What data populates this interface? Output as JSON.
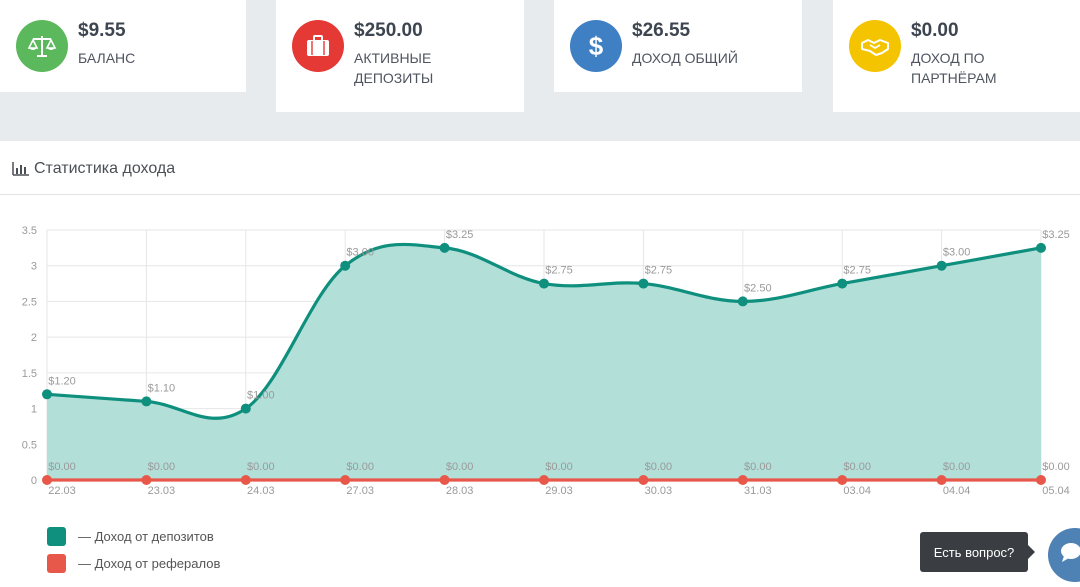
{
  "cards": [
    {
      "value": "$9.55",
      "label": "БАЛАНС",
      "icon": "balance-scale-icon",
      "color": "#5cb85c"
    },
    {
      "value": "$250.00",
      "label": "АКТИВНЫЕ ДЕПОЗИТЫ",
      "icon": "briefcase-icon",
      "color": "#e53935"
    },
    {
      "value": "$26.55",
      "label": "ДОХОД ОБЩИЙ",
      "icon": "dollar-icon",
      "color": "#3f7fc4"
    },
    {
      "value": "$0.00",
      "label": "ДОХОД ПО ПАРТНЁРАМ",
      "icon": "handshake-icon",
      "color": "#f5c400"
    }
  ],
  "panel": {
    "title": "Статистика дохода",
    "icon": "bar-chart-icon"
  },
  "chart_data": {
    "type": "area",
    "categories": [
      "22.03",
      "23.03",
      "24.03",
      "27.03",
      "28.03",
      "29.03",
      "30.03",
      "31.03",
      "03.04",
      "04.04",
      "05.04"
    ],
    "series": [
      {
        "name": "— Доход от депозитов",
        "values": [
          1.2,
          1.1,
          1.0,
          3.0,
          3.25,
          2.75,
          2.75,
          2.5,
          2.75,
          3.0,
          3.25
        ],
        "labels": [
          "$1.20",
          "$1.10",
          "$1.00",
          "$3.00",
          "$3.25",
          "$2.75",
          "$2.75",
          "$2.50",
          "$2.75",
          "$3.00",
          "$3.25"
        ],
        "color": "#0f8f7d",
        "fill": "#b3dfd9"
      },
      {
        "name": "— Доход от рефералов",
        "values": [
          0,
          0,
          0,
          0,
          0,
          0,
          0,
          0,
          0,
          0,
          0
        ],
        "labels": [
          "$0.00",
          "$0.00",
          "$0.00",
          "$0.00",
          "$0.00",
          "$0.00",
          "$0.00",
          "$0.00",
          "$0.00",
          "$0.00",
          "$0.00"
        ],
        "color": "#e8584a"
      }
    ],
    "ylim": [
      0,
      3.5
    ],
    "yticks": [
      "0",
      "0.5",
      "1",
      "1.5",
      "2",
      "2.5",
      "3",
      "3.5"
    ],
    "grid": true,
    "legend": "bottom-left"
  },
  "help": {
    "tooltip": "Есть вопрос?",
    "icon": "chat-bubble-icon"
  }
}
